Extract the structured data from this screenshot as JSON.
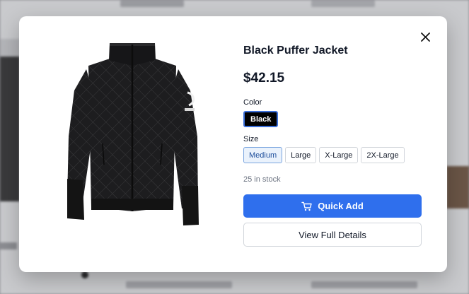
{
  "product": {
    "title": "Black Puffer Jacket",
    "price": "$42.15",
    "color_label": "Color",
    "colors": [
      {
        "label": "Black",
        "selected": true
      }
    ],
    "size_label": "Size",
    "sizes": [
      {
        "label": "Medium",
        "selected": true
      },
      {
        "label": "Large",
        "selected": false
      },
      {
        "label": "X-Large",
        "selected": false
      },
      {
        "label": "2X-Large",
        "selected": false
      }
    ],
    "stock": "25 in stock"
  },
  "actions": {
    "quick_add_label": "Quick Add",
    "view_details_label": "View Full Details"
  },
  "icons": {
    "close": "close-icon",
    "cart": "cart-icon"
  },
  "colors": {
    "accent": "#2f6fed",
    "selected_bg": "#eaf2fc",
    "text": "#111827",
    "muted": "#6b7280"
  }
}
